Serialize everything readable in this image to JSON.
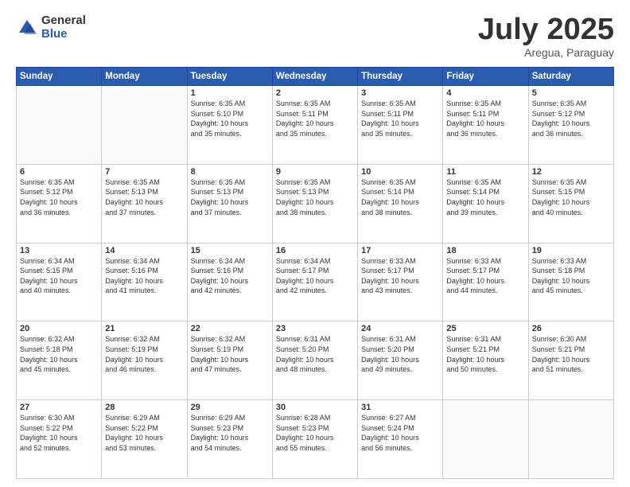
{
  "header": {
    "logo_general": "General",
    "logo_blue": "Blue",
    "title": "July 2025",
    "location": "Aregua, Paraguay"
  },
  "days_of_week": [
    "Sunday",
    "Monday",
    "Tuesday",
    "Wednesday",
    "Thursday",
    "Friday",
    "Saturday"
  ],
  "weeks": [
    [
      {
        "day": "",
        "info": ""
      },
      {
        "day": "",
        "info": ""
      },
      {
        "day": "1",
        "info": "Sunrise: 6:35 AM\nSunset: 5:10 PM\nDaylight: 10 hours\nand 35 minutes."
      },
      {
        "day": "2",
        "info": "Sunrise: 6:35 AM\nSunset: 5:11 PM\nDaylight: 10 hours\nand 35 minutes."
      },
      {
        "day": "3",
        "info": "Sunrise: 6:35 AM\nSunset: 5:11 PM\nDaylight: 10 hours\nand 35 minutes."
      },
      {
        "day": "4",
        "info": "Sunrise: 6:35 AM\nSunset: 5:11 PM\nDaylight: 10 hours\nand 36 minutes."
      },
      {
        "day": "5",
        "info": "Sunrise: 6:35 AM\nSunset: 5:12 PM\nDaylight: 10 hours\nand 36 minutes."
      }
    ],
    [
      {
        "day": "6",
        "info": "Sunrise: 6:35 AM\nSunset: 5:12 PM\nDaylight: 10 hours\nand 36 minutes."
      },
      {
        "day": "7",
        "info": "Sunrise: 6:35 AM\nSunset: 5:13 PM\nDaylight: 10 hours\nand 37 minutes."
      },
      {
        "day": "8",
        "info": "Sunrise: 6:35 AM\nSunset: 5:13 PM\nDaylight: 10 hours\nand 37 minutes."
      },
      {
        "day": "9",
        "info": "Sunrise: 6:35 AM\nSunset: 5:13 PM\nDaylight: 10 hours\nand 38 minutes."
      },
      {
        "day": "10",
        "info": "Sunrise: 6:35 AM\nSunset: 5:14 PM\nDaylight: 10 hours\nand 38 minutes."
      },
      {
        "day": "11",
        "info": "Sunrise: 6:35 AM\nSunset: 5:14 PM\nDaylight: 10 hours\nand 39 minutes."
      },
      {
        "day": "12",
        "info": "Sunrise: 6:35 AM\nSunset: 5:15 PM\nDaylight: 10 hours\nand 40 minutes."
      }
    ],
    [
      {
        "day": "13",
        "info": "Sunrise: 6:34 AM\nSunset: 5:15 PM\nDaylight: 10 hours\nand 40 minutes."
      },
      {
        "day": "14",
        "info": "Sunrise: 6:34 AM\nSunset: 5:16 PM\nDaylight: 10 hours\nand 41 minutes."
      },
      {
        "day": "15",
        "info": "Sunrise: 6:34 AM\nSunset: 5:16 PM\nDaylight: 10 hours\nand 42 minutes."
      },
      {
        "day": "16",
        "info": "Sunrise: 6:34 AM\nSunset: 5:17 PM\nDaylight: 10 hours\nand 42 minutes."
      },
      {
        "day": "17",
        "info": "Sunrise: 6:33 AM\nSunset: 5:17 PM\nDaylight: 10 hours\nand 43 minutes."
      },
      {
        "day": "18",
        "info": "Sunrise: 6:33 AM\nSunset: 5:17 PM\nDaylight: 10 hours\nand 44 minutes."
      },
      {
        "day": "19",
        "info": "Sunrise: 6:33 AM\nSunset: 5:18 PM\nDaylight: 10 hours\nand 45 minutes."
      }
    ],
    [
      {
        "day": "20",
        "info": "Sunrise: 6:32 AM\nSunset: 5:18 PM\nDaylight: 10 hours\nand 45 minutes."
      },
      {
        "day": "21",
        "info": "Sunrise: 6:32 AM\nSunset: 5:19 PM\nDaylight: 10 hours\nand 46 minutes."
      },
      {
        "day": "22",
        "info": "Sunrise: 6:32 AM\nSunset: 5:19 PM\nDaylight: 10 hours\nand 47 minutes."
      },
      {
        "day": "23",
        "info": "Sunrise: 6:31 AM\nSunset: 5:20 PM\nDaylight: 10 hours\nand 48 minutes."
      },
      {
        "day": "24",
        "info": "Sunrise: 6:31 AM\nSunset: 5:20 PM\nDaylight: 10 hours\nand 49 minutes."
      },
      {
        "day": "25",
        "info": "Sunrise: 6:31 AM\nSunset: 5:21 PM\nDaylight: 10 hours\nand 50 minutes."
      },
      {
        "day": "26",
        "info": "Sunrise: 6:30 AM\nSunset: 5:21 PM\nDaylight: 10 hours\nand 51 minutes."
      }
    ],
    [
      {
        "day": "27",
        "info": "Sunrise: 6:30 AM\nSunset: 5:22 PM\nDaylight: 10 hours\nand 52 minutes."
      },
      {
        "day": "28",
        "info": "Sunrise: 6:29 AM\nSunset: 5:22 PM\nDaylight: 10 hours\nand 53 minutes."
      },
      {
        "day": "29",
        "info": "Sunrise: 6:29 AM\nSunset: 5:23 PM\nDaylight: 10 hours\nand 54 minutes."
      },
      {
        "day": "30",
        "info": "Sunrise: 6:28 AM\nSunset: 5:23 PM\nDaylight: 10 hours\nand 55 minutes."
      },
      {
        "day": "31",
        "info": "Sunrise: 6:27 AM\nSunset: 5:24 PM\nDaylight: 10 hours\nand 56 minutes."
      },
      {
        "day": "",
        "info": ""
      },
      {
        "day": "",
        "info": ""
      }
    ]
  ]
}
